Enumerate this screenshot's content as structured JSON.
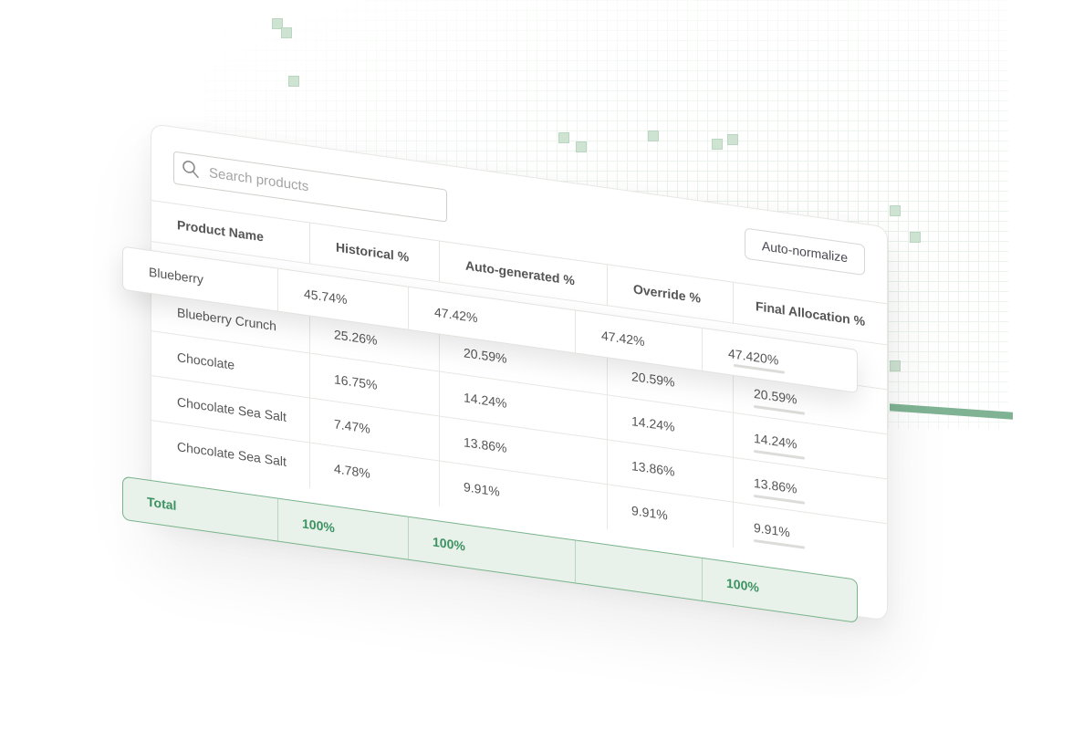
{
  "search": {
    "placeholder": "Search products"
  },
  "toolbar": {
    "autonormalize_label": "Auto-normalize"
  },
  "columns": [
    "Product Name",
    "Historical %",
    "Auto-generated %",
    "Override %",
    "Final Allocation %"
  ],
  "selected_row": {
    "product": "Blueberry",
    "historical": "45.74%",
    "auto_generated": "47.42%",
    "override": "47.42%",
    "final": "47.420%"
  },
  "rows": [
    {
      "product": "Blueberry Crunch",
      "historical": "25.26%",
      "auto_generated": "20.59%",
      "override": "20.59%",
      "final": "20.59%"
    },
    {
      "product": "Chocolate",
      "historical": "16.75%",
      "auto_generated": "14.24%",
      "override": "14.24%",
      "final": "14.24%"
    },
    {
      "product": "Chocolate Sea Salt",
      "historical": "7.47%",
      "auto_generated": "13.86%",
      "override": "13.86%",
      "final": "13.86%"
    },
    {
      "product": "Chocolate Sea Salt",
      "historical": "4.78%",
      "auto_generated": "9.91%",
      "override": "9.91%",
      "final": "9.91%"
    }
  ],
  "total": {
    "label": "Total",
    "historical": "100%",
    "auto_generated": "100%",
    "override": "",
    "final": "100%"
  },
  "colors": {
    "accent_green": "#3c9261",
    "total_bg": "#e8f1ea",
    "total_border": "#78b38b"
  }
}
